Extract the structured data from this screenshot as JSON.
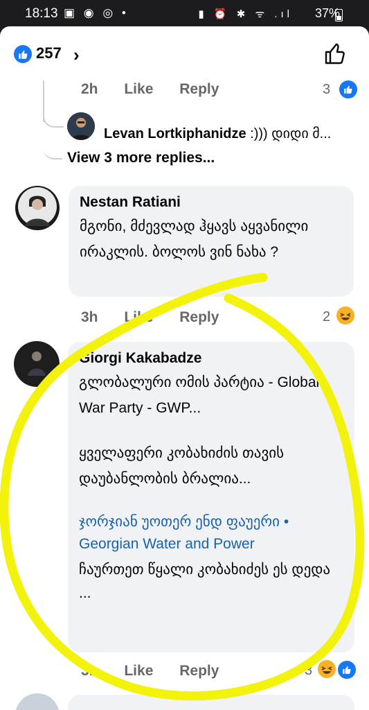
{
  "status": {
    "time": "18:13",
    "left_icons": "▣ ◉ ◎ •",
    "right_icons": "▮ ⏰ ✱ ᯤ .ıl",
    "battery": "37%"
  },
  "header": {
    "like_count": "257",
    "chevron": "›"
  },
  "comment0": {
    "time": "2h",
    "like_label": "Like",
    "reply_label": "Reply",
    "reaction_count": "3",
    "reply_author": "Levan Lortkiphanidze",
    "reply_text": ":))) დიდი მ...",
    "view_more": "View 3 more replies..."
  },
  "comment1": {
    "author": "Nestan Ratiani",
    "text": "მგონი, მძევლად ჰყავს აყვანილი ირაკლის. ბოლოს ვინ ნახა ?",
    "time": "3h",
    "like_label": "Like",
    "reply_label": "Reply",
    "reaction_count": "2"
  },
  "comment2": {
    "author": "Giorgi Kakabadze",
    "text1": "გლობალური ომის პარტია - Global War Party - GWP...",
    "text2": "ყველაფერი კობახიძის თავის დაუბანლობის ბრალია...",
    "link_text": "ჯორჯიან უოთერ ენდ ფაუერი • Georgian Water and Power",
    "text3": "ჩაურთეთ წყალი კობახიძეს ეს დედა ...",
    "time": "3h",
    "like_label": "Like",
    "reply_label": "Reply",
    "reaction_count": "3"
  },
  "colors": {
    "facebook_blue": "#1877f2",
    "highlight_yellow": "#f2f20a",
    "bubble_gray": "#f0f2f5"
  }
}
